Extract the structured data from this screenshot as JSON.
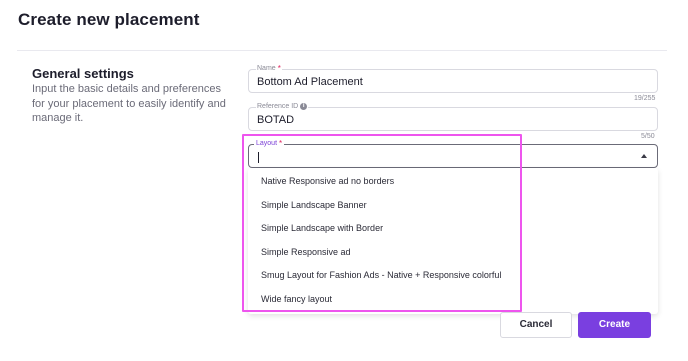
{
  "page": {
    "title": "Create new placement"
  },
  "general_settings": {
    "title": "General settings",
    "description": "Input the basic details and preferences for your placement to easily identify and manage it."
  },
  "fields": {
    "name": {
      "label": "Name",
      "required_mark": "*",
      "value": "Bottom Ad Placement",
      "counter": "19/255"
    },
    "reference_id": {
      "label": "Reference ID",
      "info_icon": "i",
      "value": "BOTAD",
      "counter": "5/50"
    },
    "layout": {
      "label": "Layout",
      "required_mark": "*",
      "value": ""
    }
  },
  "layout_options": [
    "Native Responsive ad no borders",
    "Simple Landscape Banner",
    "Simple Landscape with Border",
    "Simple Responsive ad",
    "Smug Layout for Fashion Ads - Native + Responsive colorful",
    "Wide fancy layout"
  ],
  "buttons": {
    "cancel": "Cancel",
    "create": "Create"
  },
  "colors": {
    "accent": "#7a3fe0",
    "highlight": "#ee55ee",
    "required": "#e0245e"
  }
}
